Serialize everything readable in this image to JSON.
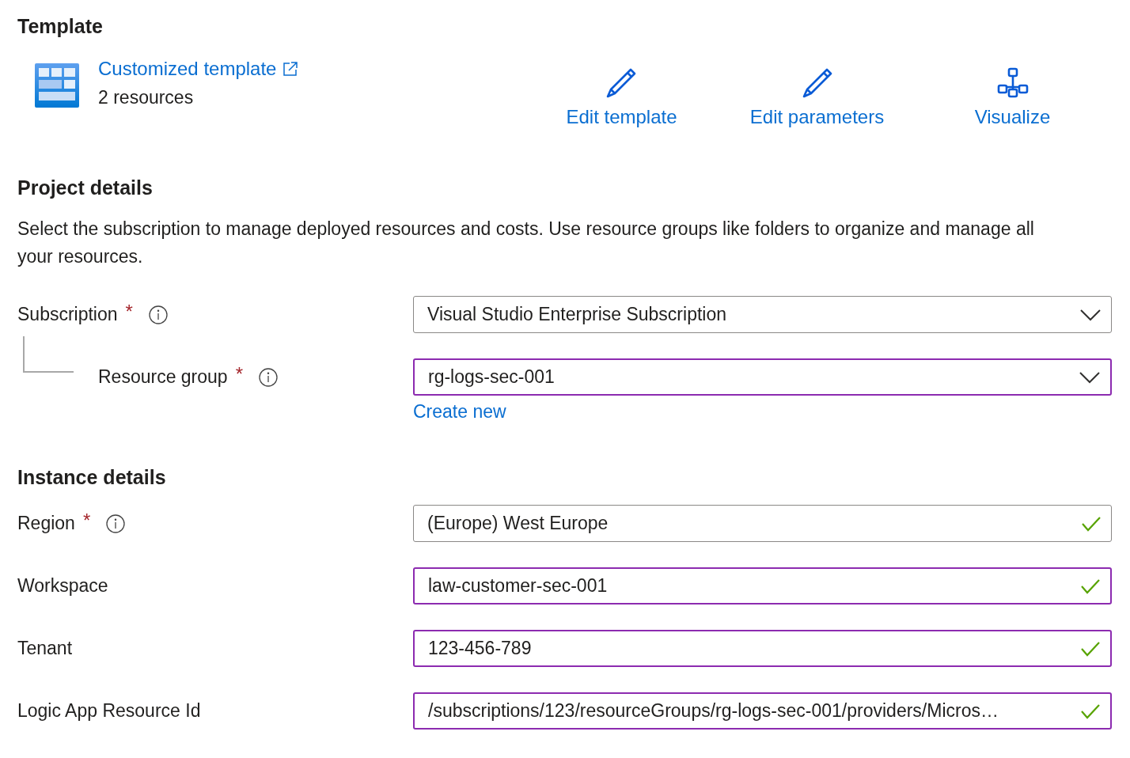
{
  "template": {
    "heading": "Template",
    "name": "Customized template",
    "count": "2 resources",
    "actions": [
      {
        "label": "Edit template",
        "kind": "edit"
      },
      {
        "label": "Edit parameters",
        "kind": "edit"
      },
      {
        "label": "Visualize",
        "kind": "view"
      }
    ]
  },
  "project": {
    "heading": "Project details",
    "description": "Select the subscription to manage deployed resources and costs. Use resource groups like folders to organize and manage all your resources.",
    "fields": [
      {
        "label": "Subscription",
        "required": "*",
        "info": true,
        "value": "Visual Studio Enterprise Subscription",
        "kind": "dropdown",
        "modified": false,
        "children": [
          {
            "label": "Resource group",
            "required": "*",
            "info": true,
            "value": "rg-logs-sec-001",
            "kind": "dropdown",
            "modified": true,
            "link": "Create new"
          }
        ]
      }
    ]
  },
  "instance": {
    "heading": "Instance details",
    "fields": [
      {
        "label": "Region",
        "required": "*",
        "info": true,
        "value": "(Europe) West Europe",
        "kind": "validated",
        "modified": false
      },
      {
        "label": "Workspace",
        "info": false,
        "value": "law-customer-sec-001",
        "kind": "validated",
        "modified": true
      },
      {
        "label": "Tenant",
        "info": false,
        "value": "123-456-789",
        "kind": "validated",
        "modified": true
      },
      {
        "label": "Logic App Resource Id",
        "info": false,
        "value": "/subscriptions/123/resourceGroups/rg-logs-sec-001/providers/Micros…",
        "kind": "validated",
        "modified": true
      }
    ]
  }
}
